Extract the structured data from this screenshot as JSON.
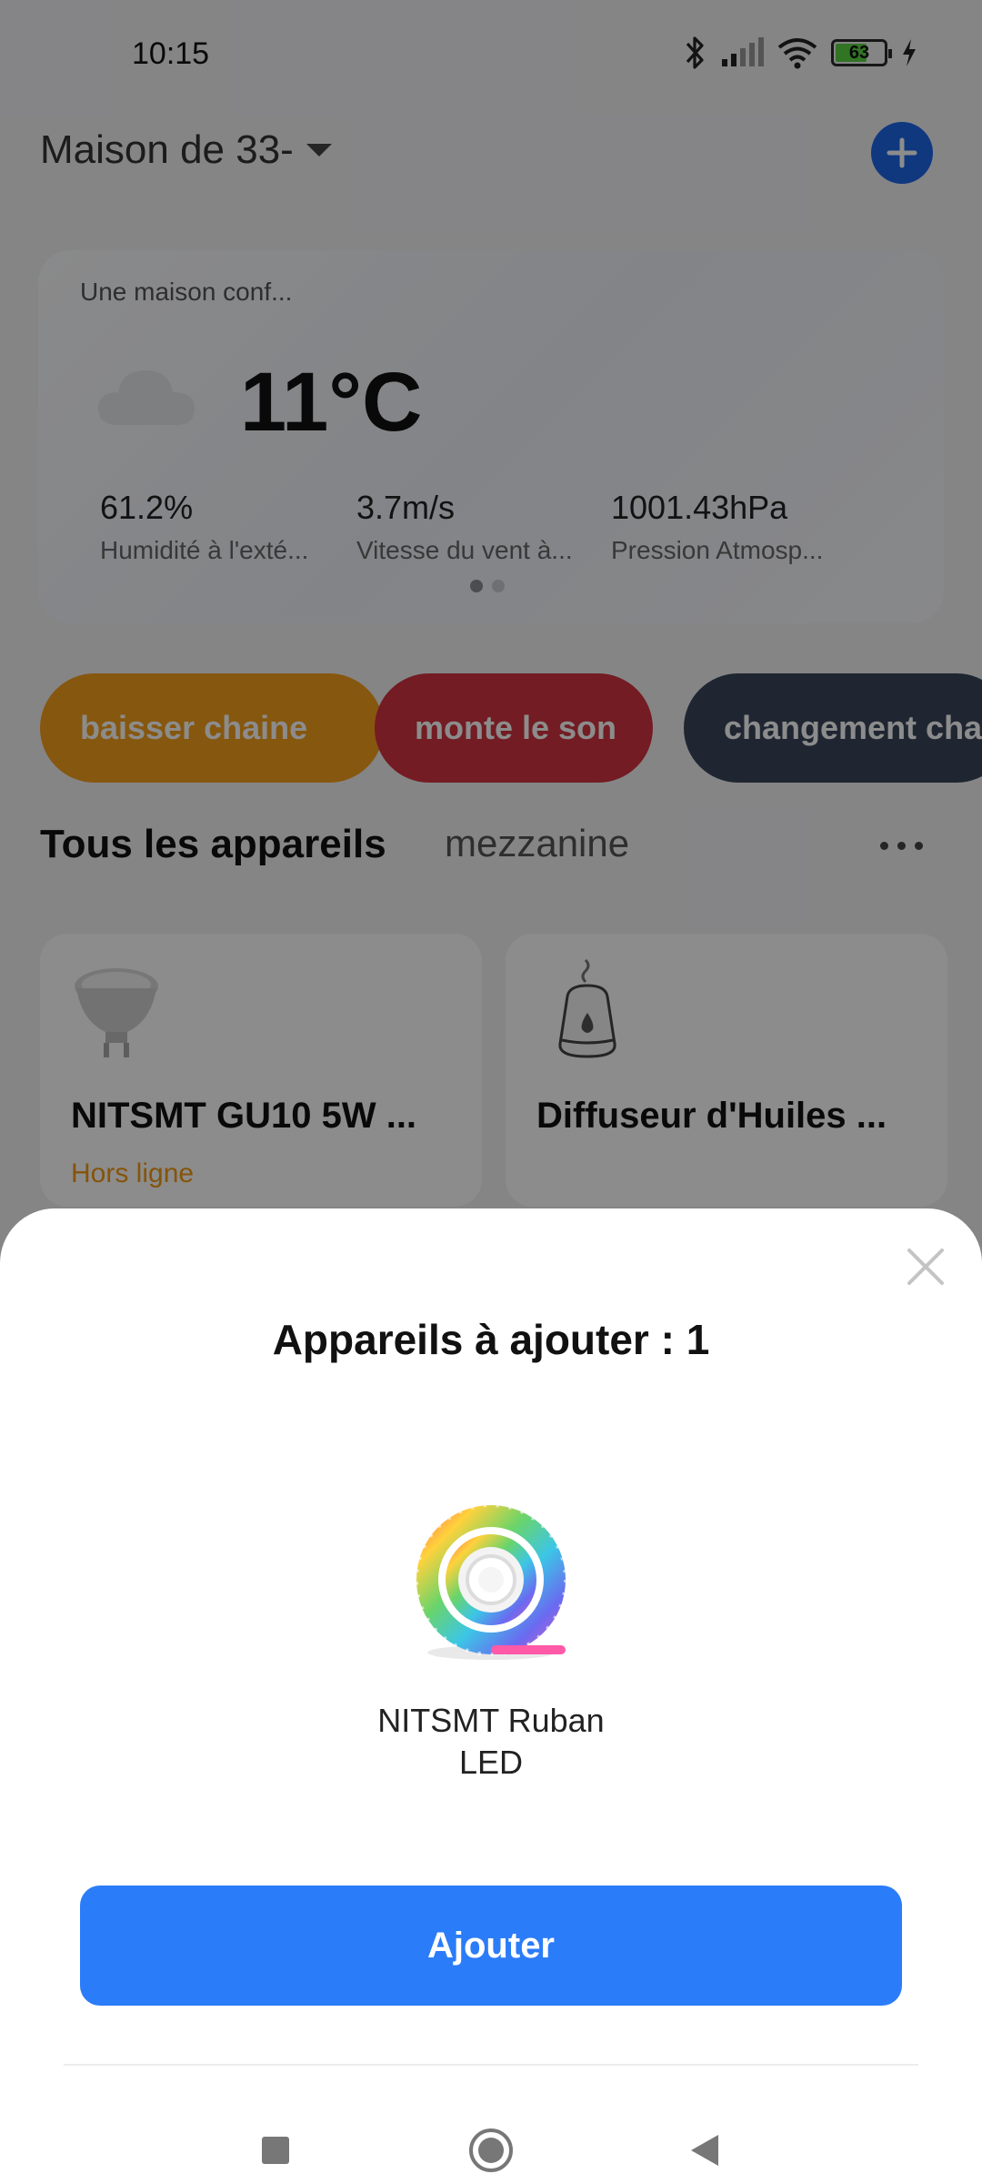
{
  "status_bar": {
    "time": "10:15",
    "battery": "63"
  },
  "home": {
    "title": "Maison de 33-"
  },
  "weather": {
    "subtitle": "Une maison conf...",
    "temperature": "11°C",
    "stats": [
      {
        "value": "61.2%",
        "label": "Humidité à l'exté..."
      },
      {
        "value": "3.7m/s",
        "label": "Vitesse du vent à..."
      },
      {
        "value": "1001.43hPa",
        "label": "Pression Atmosp..."
      }
    ]
  },
  "scenes": [
    {
      "label": "baisser chaine",
      "color": "#f59f1d"
    },
    {
      "label": "monte le son",
      "color": "#d23340"
    },
    {
      "label": "changement chaine",
      "color": "#394659"
    }
  ],
  "tabs": {
    "all": "Tous les appareils",
    "room": "mezzanine"
  },
  "devices": [
    {
      "name": "NITSMT GU10 5W ...",
      "status": "Hors ligne"
    },
    {
      "name": "Diffuseur d'Huiles ...",
      "status": ""
    }
  ],
  "sheet": {
    "title": "Appareils à ajouter : 1",
    "device_line1": "NITSMT Ruban",
    "device_line2": "LED",
    "button": "Ajouter"
  },
  "colors": {
    "primary": "#2b7cf8",
    "accent_blue": "#1e66e8",
    "offline": "#f29a15"
  },
  "icons": [
    "bluetooth-icon",
    "signal-icon",
    "wifi-icon",
    "battery-icon",
    "charging-icon",
    "add-icon",
    "cloud-icon",
    "bulb-icon",
    "diffuser-icon",
    "close-icon",
    "led-strip-icon",
    "square-icon",
    "circle-icon",
    "back-icon"
  ]
}
